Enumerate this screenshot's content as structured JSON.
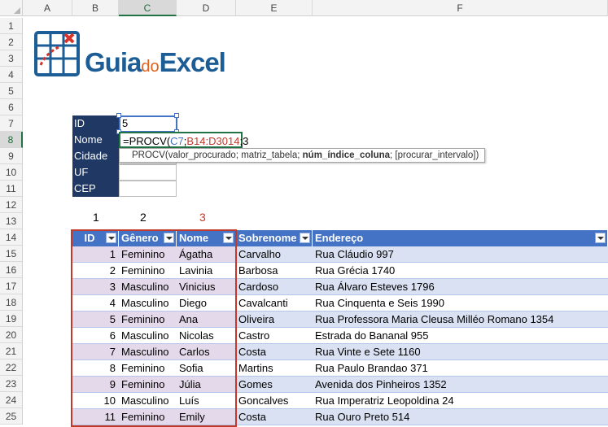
{
  "columns": [
    "A",
    "B",
    "C",
    "D",
    "E",
    "F"
  ],
  "selected_column": "C",
  "rows": [
    "1",
    "2",
    "3",
    "4",
    "5",
    "6",
    "7",
    "8",
    "9",
    "10",
    "11",
    "12",
    "13",
    "14",
    "15",
    "16",
    "17",
    "18",
    "19",
    "20",
    "21",
    "22",
    "23",
    "24",
    "25"
  ],
  "selected_row": "8",
  "logo": {
    "part1": "Guia",
    "part2": "do",
    "part3": "Excel"
  },
  "lookup_panel": {
    "labels": [
      "ID",
      "Nome",
      "Cidade",
      "UF",
      "CEP"
    ],
    "id_value": "5"
  },
  "formula": {
    "prefix": "=PROCV(",
    "ref1": "C7",
    "sep1": ";",
    "ref2": "B14:D3014",
    "suffix": ";3"
  },
  "tooltip": {
    "text_start": "PROCV(valor_procurado; matriz_tabela; ",
    "bold_arg": "núm_índice_coluna",
    "text_end": "; [procurar_intervalo])"
  },
  "col_numbers": [
    "1",
    "2",
    "3"
  ],
  "table": {
    "headers": [
      "ID",
      "Gênero",
      "Nome",
      "Sobrenome",
      "Endereço"
    ],
    "rows": [
      [
        "1",
        "Feminino",
        "Ágatha",
        "Carvalho",
        "Rua Cláudio 997"
      ],
      [
        "2",
        "Feminino",
        "Lavinia",
        "Barbosa",
        "Rua Grécia 1740"
      ],
      [
        "3",
        "Masculino",
        "Vinicius",
        "Cardoso",
        "Rua Álvaro Esteves 1796"
      ],
      [
        "4",
        "Masculino",
        "Diego",
        "Cavalcanti",
        "Rua Cinquenta e Seis 1990"
      ],
      [
        "5",
        "Feminino",
        "Ana",
        "Oliveira",
        "Rua Professora Maria Cleusa Milléo Romano 1354"
      ],
      [
        "6",
        "Masculino",
        "Nicolas",
        "Castro",
        "Estrada do Bananal 955"
      ],
      [
        "7",
        "Masculino",
        "Carlos",
        "Costa",
        "Rua Vinte e Sete 1160"
      ],
      [
        "8",
        "Feminino",
        "Sofia",
        "Martins",
        "Rua Paulo Brandao 371"
      ],
      [
        "9",
        "Feminino",
        "Júlia",
        "Gomes",
        "Avenida dos Pinheiros 1352"
      ],
      [
        "10",
        "Masculino",
        "Luís",
        "Goncalves",
        "Rua Imperatriz Leopoldina 24"
      ],
      [
        "11",
        "Feminino",
        "Emily",
        "Costa",
        "Rua Ouro Preto 514"
      ]
    ]
  },
  "colors": {
    "header_blue": "#4472c4",
    "panel_navy": "#1f3864",
    "row_band": "#d9e1f2",
    "highlight_red": "#c0392b",
    "selected_band": "#e4d9ea"
  }
}
